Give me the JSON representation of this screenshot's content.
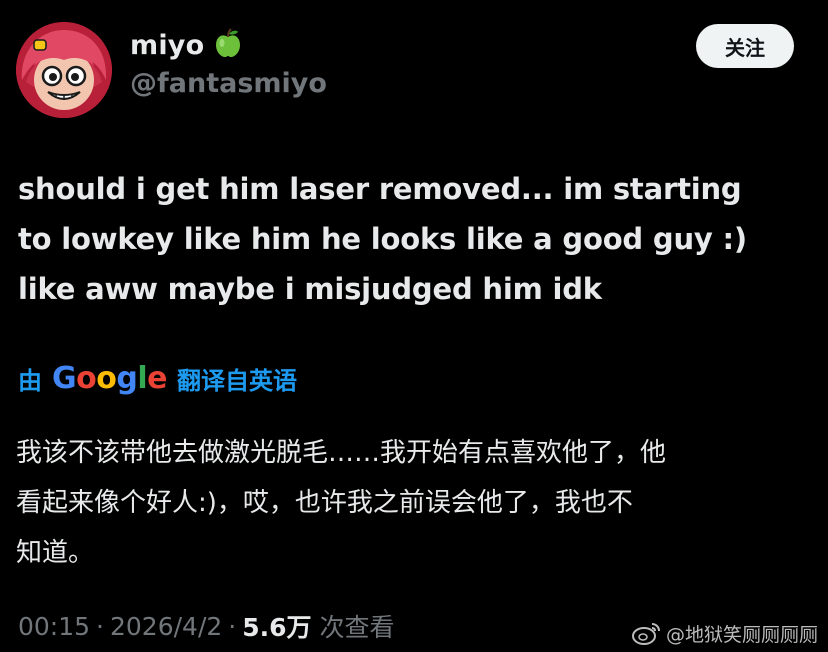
{
  "profile": {
    "display_name": "miyo",
    "badge_icon": "green-apple-icon",
    "handle": "@fantasmiyo",
    "follow_label": "关注"
  },
  "tweet": {
    "lines": [
      "should i get him laser removed... im starting",
      "to lowkey like him he looks like a good guy :)",
      "like aww maybe i misjudged him idk"
    ]
  },
  "translation": {
    "prefix": "由",
    "provider": "Google",
    "suffix": "翻译自英语",
    "lines": [
      "我该不该带他去做激光脱毛……我开始有点喜欢他了，他",
      "看起来像个好人:)，哎，也许我之前误会他了，我也不",
      "知道。"
    ]
  },
  "meta": {
    "time": "00:15",
    "date": "2026/4/2",
    "views_count": "5.6万",
    "views_label": "次查看",
    "separator": "·"
  },
  "watermark": {
    "text": "@地狱笑厕厕厕厕"
  },
  "colors": {
    "background": "#000000",
    "primary_text": "#e7e9ea",
    "secondary_text": "#71767b",
    "link_blue": "#1d9bf0",
    "follow_bg": "#eff3f4"
  }
}
